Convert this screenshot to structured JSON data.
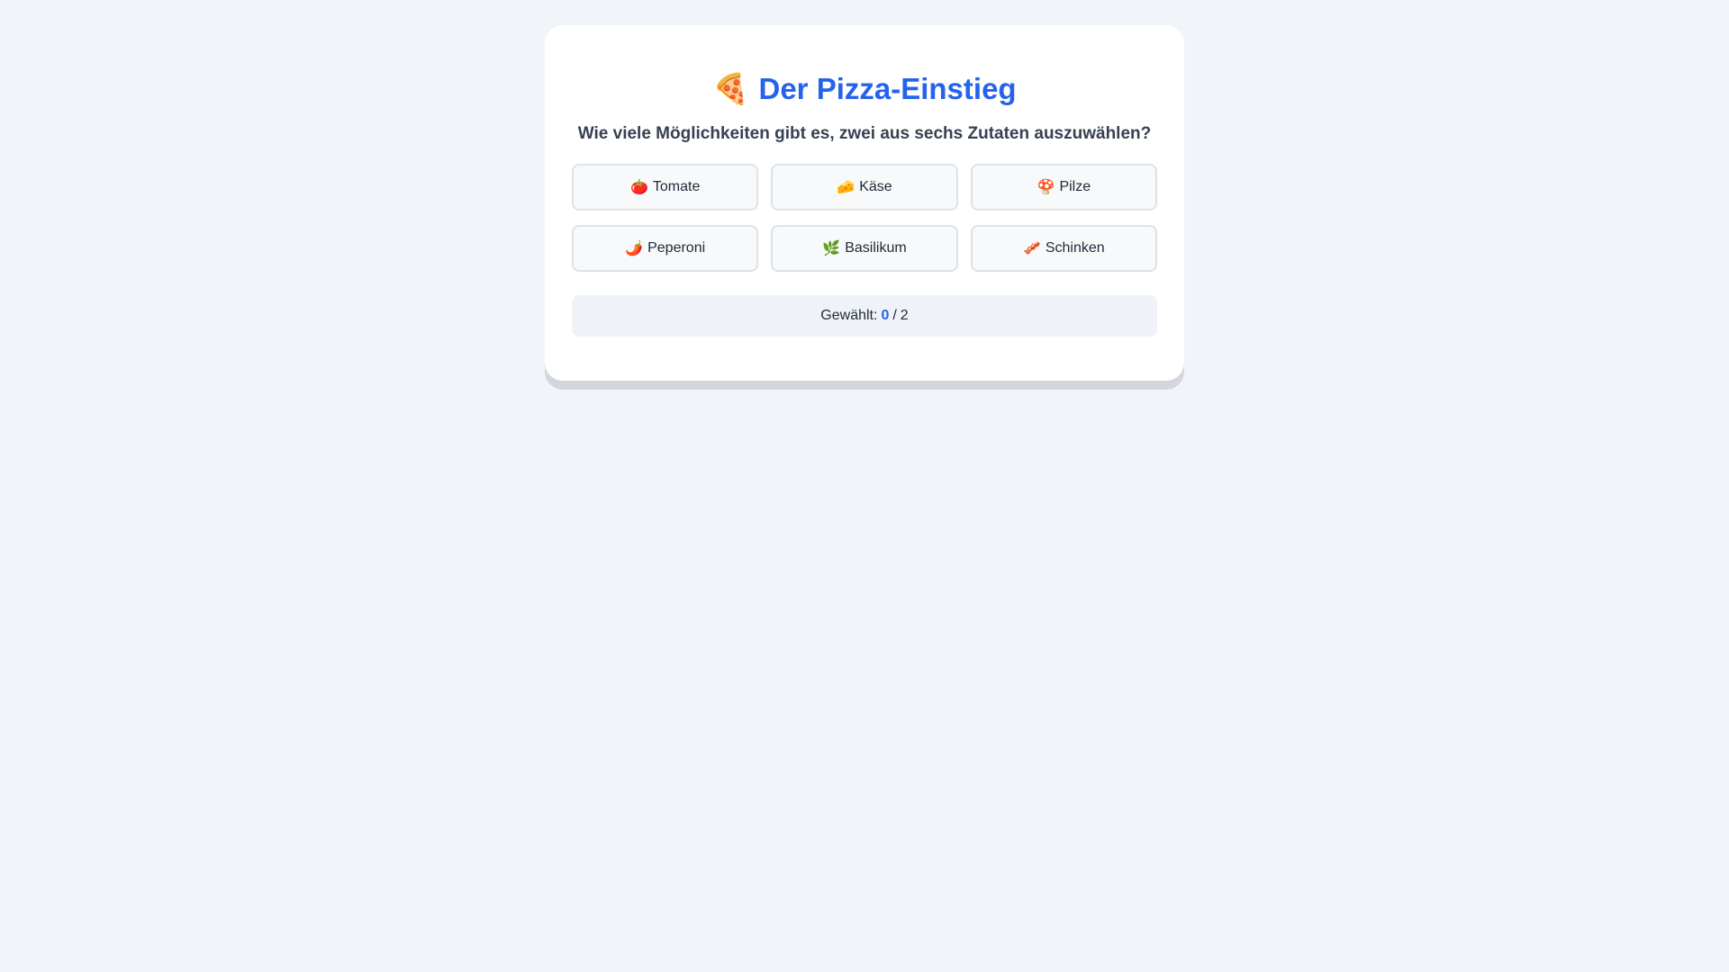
{
  "header": {
    "icon": "🍕",
    "title": "Der Pizza-Einstieg"
  },
  "question": "Wie viele Möglichkeiten gibt es, zwei aus sechs Zutaten auszuwählen?",
  "ingredients": [
    {
      "icon": "🍅",
      "label": "Tomate"
    },
    {
      "icon": "🧀",
      "label": "Käse"
    },
    {
      "icon": "🍄",
      "label": "Pilze"
    },
    {
      "icon": "🌶️",
      "label": "Peperoni"
    },
    {
      "icon": "🌿",
      "label": "Basilikum"
    },
    {
      "icon": "🥓",
      "label": "Schinken"
    }
  ],
  "status": {
    "label": "Gewählt:",
    "selected": "0",
    "separator": "/",
    "total": "2"
  },
  "colors": {
    "accent": "#2563eb",
    "background": "#f1f4f8",
    "card": "#ffffff"
  }
}
